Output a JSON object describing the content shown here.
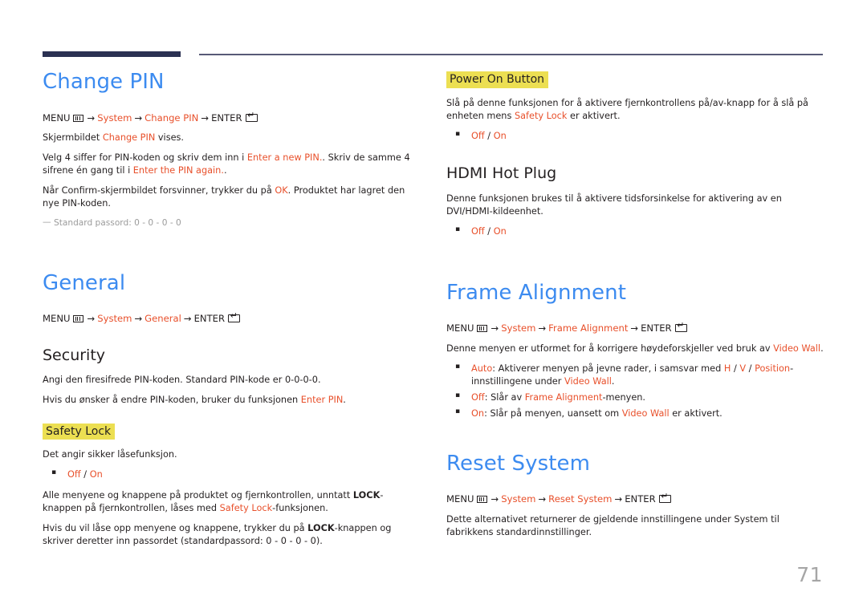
{
  "page": {
    "number": "71",
    "accent_blue": "#3c8bf0",
    "accent_red": "#e8502b",
    "highlight_yellow": "#ecdf52",
    "rule_dark": "#2b3152",
    "rule_thin": "#575a77"
  },
  "icons": {
    "menu_label": "MENU",
    "enter_label": "ENTER",
    "arrow": "→"
  },
  "left": {
    "change_pin": {
      "title": "Change PIN",
      "path": {
        "menu": "MENU",
        "item1": "System",
        "item2": "Change PIN",
        "enter": "ENTER"
      },
      "p1_a": "Skjermbildet ",
      "p1_red": "Change PIN",
      "p1_b": " vises.",
      "p2_a": "Velg 4 siffer for PIN-koden og skriv dem inn i ",
      "p2_red1": "Enter a new PIN.",
      "p2_b": ". Skriv de samme 4 sifrene én gang til i ",
      "p2_red2": "Enter the PIN again.",
      "p2_c": ".",
      "p3_a": "Når Confirm-skjermbildet forsvinner, trykker du på ",
      "p3_red": "OK",
      "p3_b": ". Produktet har lagret den nye PIN-koden.",
      "note": "Standard passord: 0 - 0 - 0 - 0"
    },
    "general": {
      "title": "General",
      "path": {
        "menu": "MENU",
        "item1": "System",
        "item2": "General",
        "enter": "ENTER"
      }
    },
    "security": {
      "title": "Security",
      "p1": "Angi den firesifrede PIN-koden. Standard PIN-kode er 0-0-0-0.",
      "p2_a": "Hvis du ønsker å endre PIN-koden, bruker du funksjonen ",
      "p2_red": "Enter PIN",
      "p2_b": "."
    },
    "safety_lock": {
      "title": "Safety Lock",
      "p1": "Det angir sikker låsefunksjon.",
      "options": {
        "off": "Off",
        "separator": " / ",
        "on": "On"
      },
      "p2_a": "Alle menyene og knappene på produktet og fjernkontrollen, unntatt ",
      "p2_bold": "LOCK",
      "p2_b": "-knappen på fjernkontrollen, låses med ",
      "p2_red": "Safety Lock",
      "p2_c": "-funksjonen.",
      "p3_a": "Hvis du vil låse opp menyene og knappene, trykker du på ",
      "p3_bold": "LOCK",
      "p3_b": "-knappen og skriver deretter inn passordet (standardpassord: 0 - 0 - 0 - 0)."
    }
  },
  "right": {
    "power_on_button": {
      "title": "Power On Button",
      "p1_a": "Slå på denne funksjonen for å aktivere fjernkontrollens på/av-knapp for å slå på enheten mens ",
      "p1_red": "Safety Lock",
      "p1_b": " er aktivert.",
      "options": {
        "off": "Off",
        "separator": " / ",
        "on": "On"
      }
    },
    "hdmi_hot_plug": {
      "title": "HDMI Hot Plug",
      "p1": "Denne funksjonen brukes til å aktivere tidsforsinkelse for aktivering av en DVI/HDMI-kildeenhet.",
      "options": {
        "off": "Off",
        "separator": " / ",
        "on": "On"
      }
    },
    "frame_alignment": {
      "title": "Frame Alignment",
      "path": {
        "menu": "MENU",
        "item1": "System",
        "item2": "Frame Alignment",
        "enter": "ENTER"
      },
      "p1_a": "Denne menyen er utformet for å korrigere høydeforskjeller ved bruk av ",
      "p1_red": "Video Wall",
      "p1_b": ".",
      "b1_red1": "Auto",
      "b1_a": ": Aktiverer menyen på jevne rader, i samsvar med ",
      "b1_red2": "H",
      "b1_sep1": " / ",
      "b1_red3": "V",
      "b1_sep2": " / ",
      "b1_red4": "Position",
      "b1_b": "-innstillingene under ",
      "b1_red5": "Video Wall",
      "b1_c": ".",
      "b2_red1": "Off",
      "b2_a": ": Slår av ",
      "b2_red2": "Frame Alignment",
      "b2_b": "-menyen.",
      "b3_red1": "On",
      "b3_a": ": Slår på menyen, uansett om ",
      "b3_red2": "Video Wall",
      "b3_b": " er aktivert."
    },
    "reset_system": {
      "title": "Reset System",
      "path": {
        "menu": "MENU",
        "item1": "System",
        "item2": "Reset System",
        "enter": "ENTER"
      },
      "p1": "Dette alternativet returnerer de gjeldende innstillingene under System til fabrikkens standardinnstillinger."
    }
  }
}
